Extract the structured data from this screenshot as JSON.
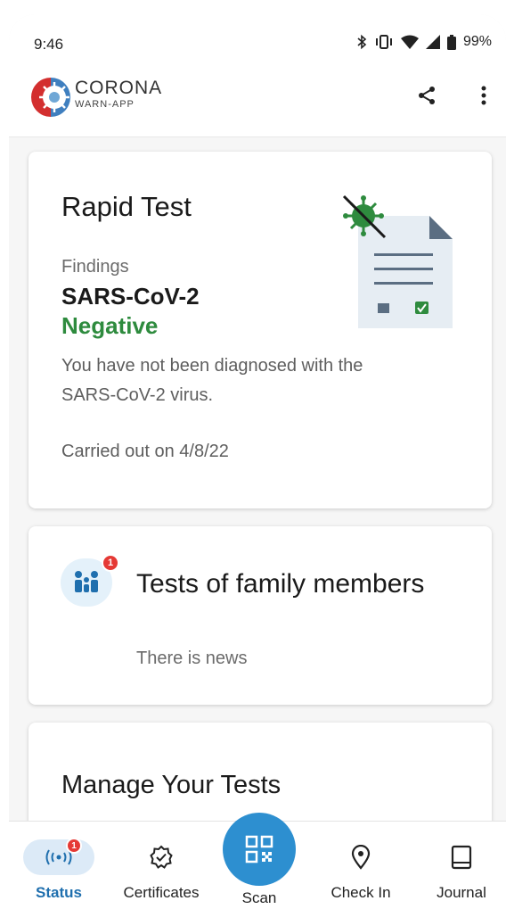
{
  "status_bar": {
    "time": "9:46",
    "battery": "99%"
  },
  "header": {
    "logo_name": "CORONA",
    "logo_sub": "WARN-APP",
    "share_icon": "share-icon",
    "more_icon": "more-vert-icon"
  },
  "test_card": {
    "title": "Rapid Test",
    "findings_label": "Findings",
    "virus": "SARS-CoV-2",
    "result": "Negative",
    "description": "You have not been diagnosed with the SARS-CoV-2 virus.",
    "date": "Carried out on 4/8/22",
    "result_color": "#2e8b3e"
  },
  "family_card": {
    "badge": "1",
    "title": "Tests of family members",
    "subtitle": "There is news"
  },
  "manage_card": {
    "title": "Manage Your Tests"
  },
  "nav": {
    "items": [
      {
        "label": "Status",
        "icon": "status-radar-icon",
        "badge": "1",
        "active": true
      },
      {
        "label": "Certificates",
        "icon": "certificate-icon"
      },
      {
        "label": "Scan",
        "icon": "qr-scan-icon"
      },
      {
        "label": "Check In",
        "icon": "location-pin-icon"
      },
      {
        "label": "Journal",
        "icon": "journal-book-icon"
      }
    ]
  },
  "colors": {
    "accent": "#2d8fd0",
    "active_nav": "#1f6fae",
    "badge": "#e53935"
  }
}
